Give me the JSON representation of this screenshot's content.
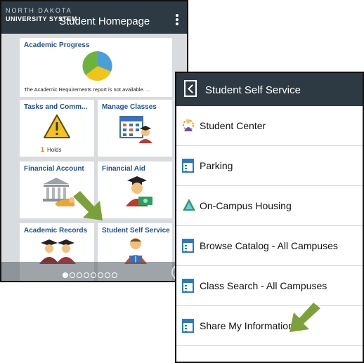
{
  "homepage": {
    "logo_line1": "NORTH DAKOTA",
    "logo_line2": "UNIVERSITY SYSTEM",
    "title": "Student Homepage",
    "tiles": {
      "academic_progress": {
        "title": "Academic Progress",
        "note": "The Academic Requirements report is not available.  ...",
        "pie_colors": [
          "#4a9fd8",
          "#6cb33e",
          "#f2c417"
        ]
      },
      "tasks": {
        "title": "Tasks and Comm...",
        "holds_count": "1",
        "holds_label": "Holds"
      },
      "manage_classes": {
        "title": "Manage Classes"
      },
      "financial_account": {
        "title": "Financial Account"
      },
      "financial_aid": {
        "title": "Financial Aid"
      },
      "academic_records": {
        "title": "Academic Records"
      },
      "student_self_service": {
        "title": "Student Self Service"
      }
    },
    "pager": {
      "total": 8,
      "active": 0
    }
  },
  "self_service": {
    "title": "Student Self Service",
    "items": [
      {
        "label": "Student Center",
        "icon": "student-center-icon"
      },
      {
        "label": "Parking",
        "icon": "document-icon"
      },
      {
        "label": "On-Campus Housing",
        "icon": "housing-icon"
      },
      {
        "label": "Browse Catalog - All Campuses",
        "icon": "document-icon"
      },
      {
        "label": "Class Search - All Campuses",
        "icon": "document-icon"
      },
      {
        "label": "Share My Information",
        "icon": "document-icon"
      }
    ]
  },
  "colors": {
    "header": "#2d3a43",
    "tile_title": "#1f4f94",
    "arrow": "#7da13a",
    "holds": "#e57a00"
  }
}
